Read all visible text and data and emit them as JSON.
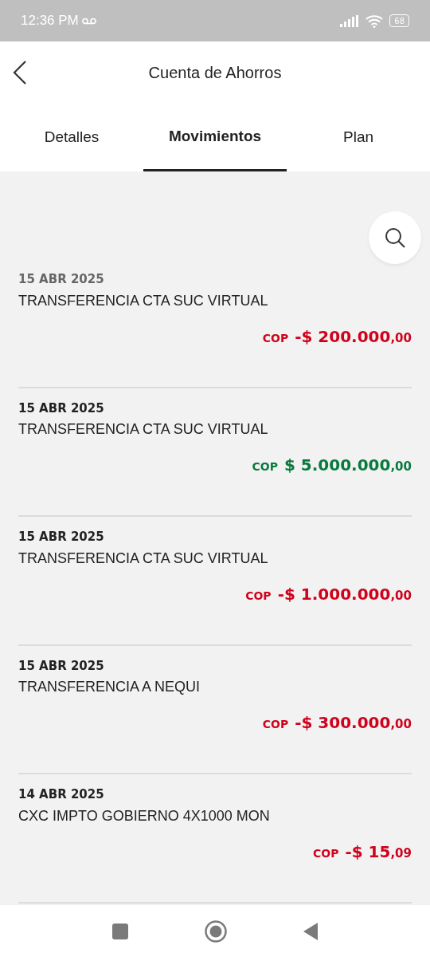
{
  "status_bar": {
    "time": "12:36 PM",
    "battery": "68"
  },
  "header": {
    "title": "Cuenta de Ahorros"
  },
  "tabs": [
    {
      "label": "Detalles",
      "selected": false
    },
    {
      "label": "Movimientos",
      "selected": true
    },
    {
      "label": "Plan",
      "selected": false
    }
  ],
  "movements": [
    {
      "date": "15 ABR 2025",
      "description": "TRANSFERENCIA CTA SUC VIRTUAL",
      "currency": "COP",
      "amount": "-$ 200.000",
      "cents": ",00",
      "kind": "debit"
    },
    {
      "date": "15 ABR 2025",
      "description": "TRANSFERENCIA CTA SUC VIRTUAL",
      "currency": "COP",
      "amount": "$ 5.000.000",
      "cents": ",00",
      "kind": "credit"
    },
    {
      "date": "15 ABR 2025",
      "description": "TRANSFERENCIA CTA SUC VIRTUAL",
      "currency": "COP",
      "amount": "-$ 1.000.000",
      "cents": ",00",
      "kind": "debit"
    },
    {
      "date": "15 ABR 2025",
      "description": "TRANSFERENCIA A NEQUI",
      "currency": "COP",
      "amount": "-$ 300.000",
      "cents": ",00",
      "kind": "debit"
    },
    {
      "date": "14 ABR 2025",
      "description": "CXC IMPTO GOBIERNO 4X1000 MON",
      "currency": "COP",
      "amount": "-$ 15",
      "cents": ",09",
      "kind": "debit"
    }
  ]
}
